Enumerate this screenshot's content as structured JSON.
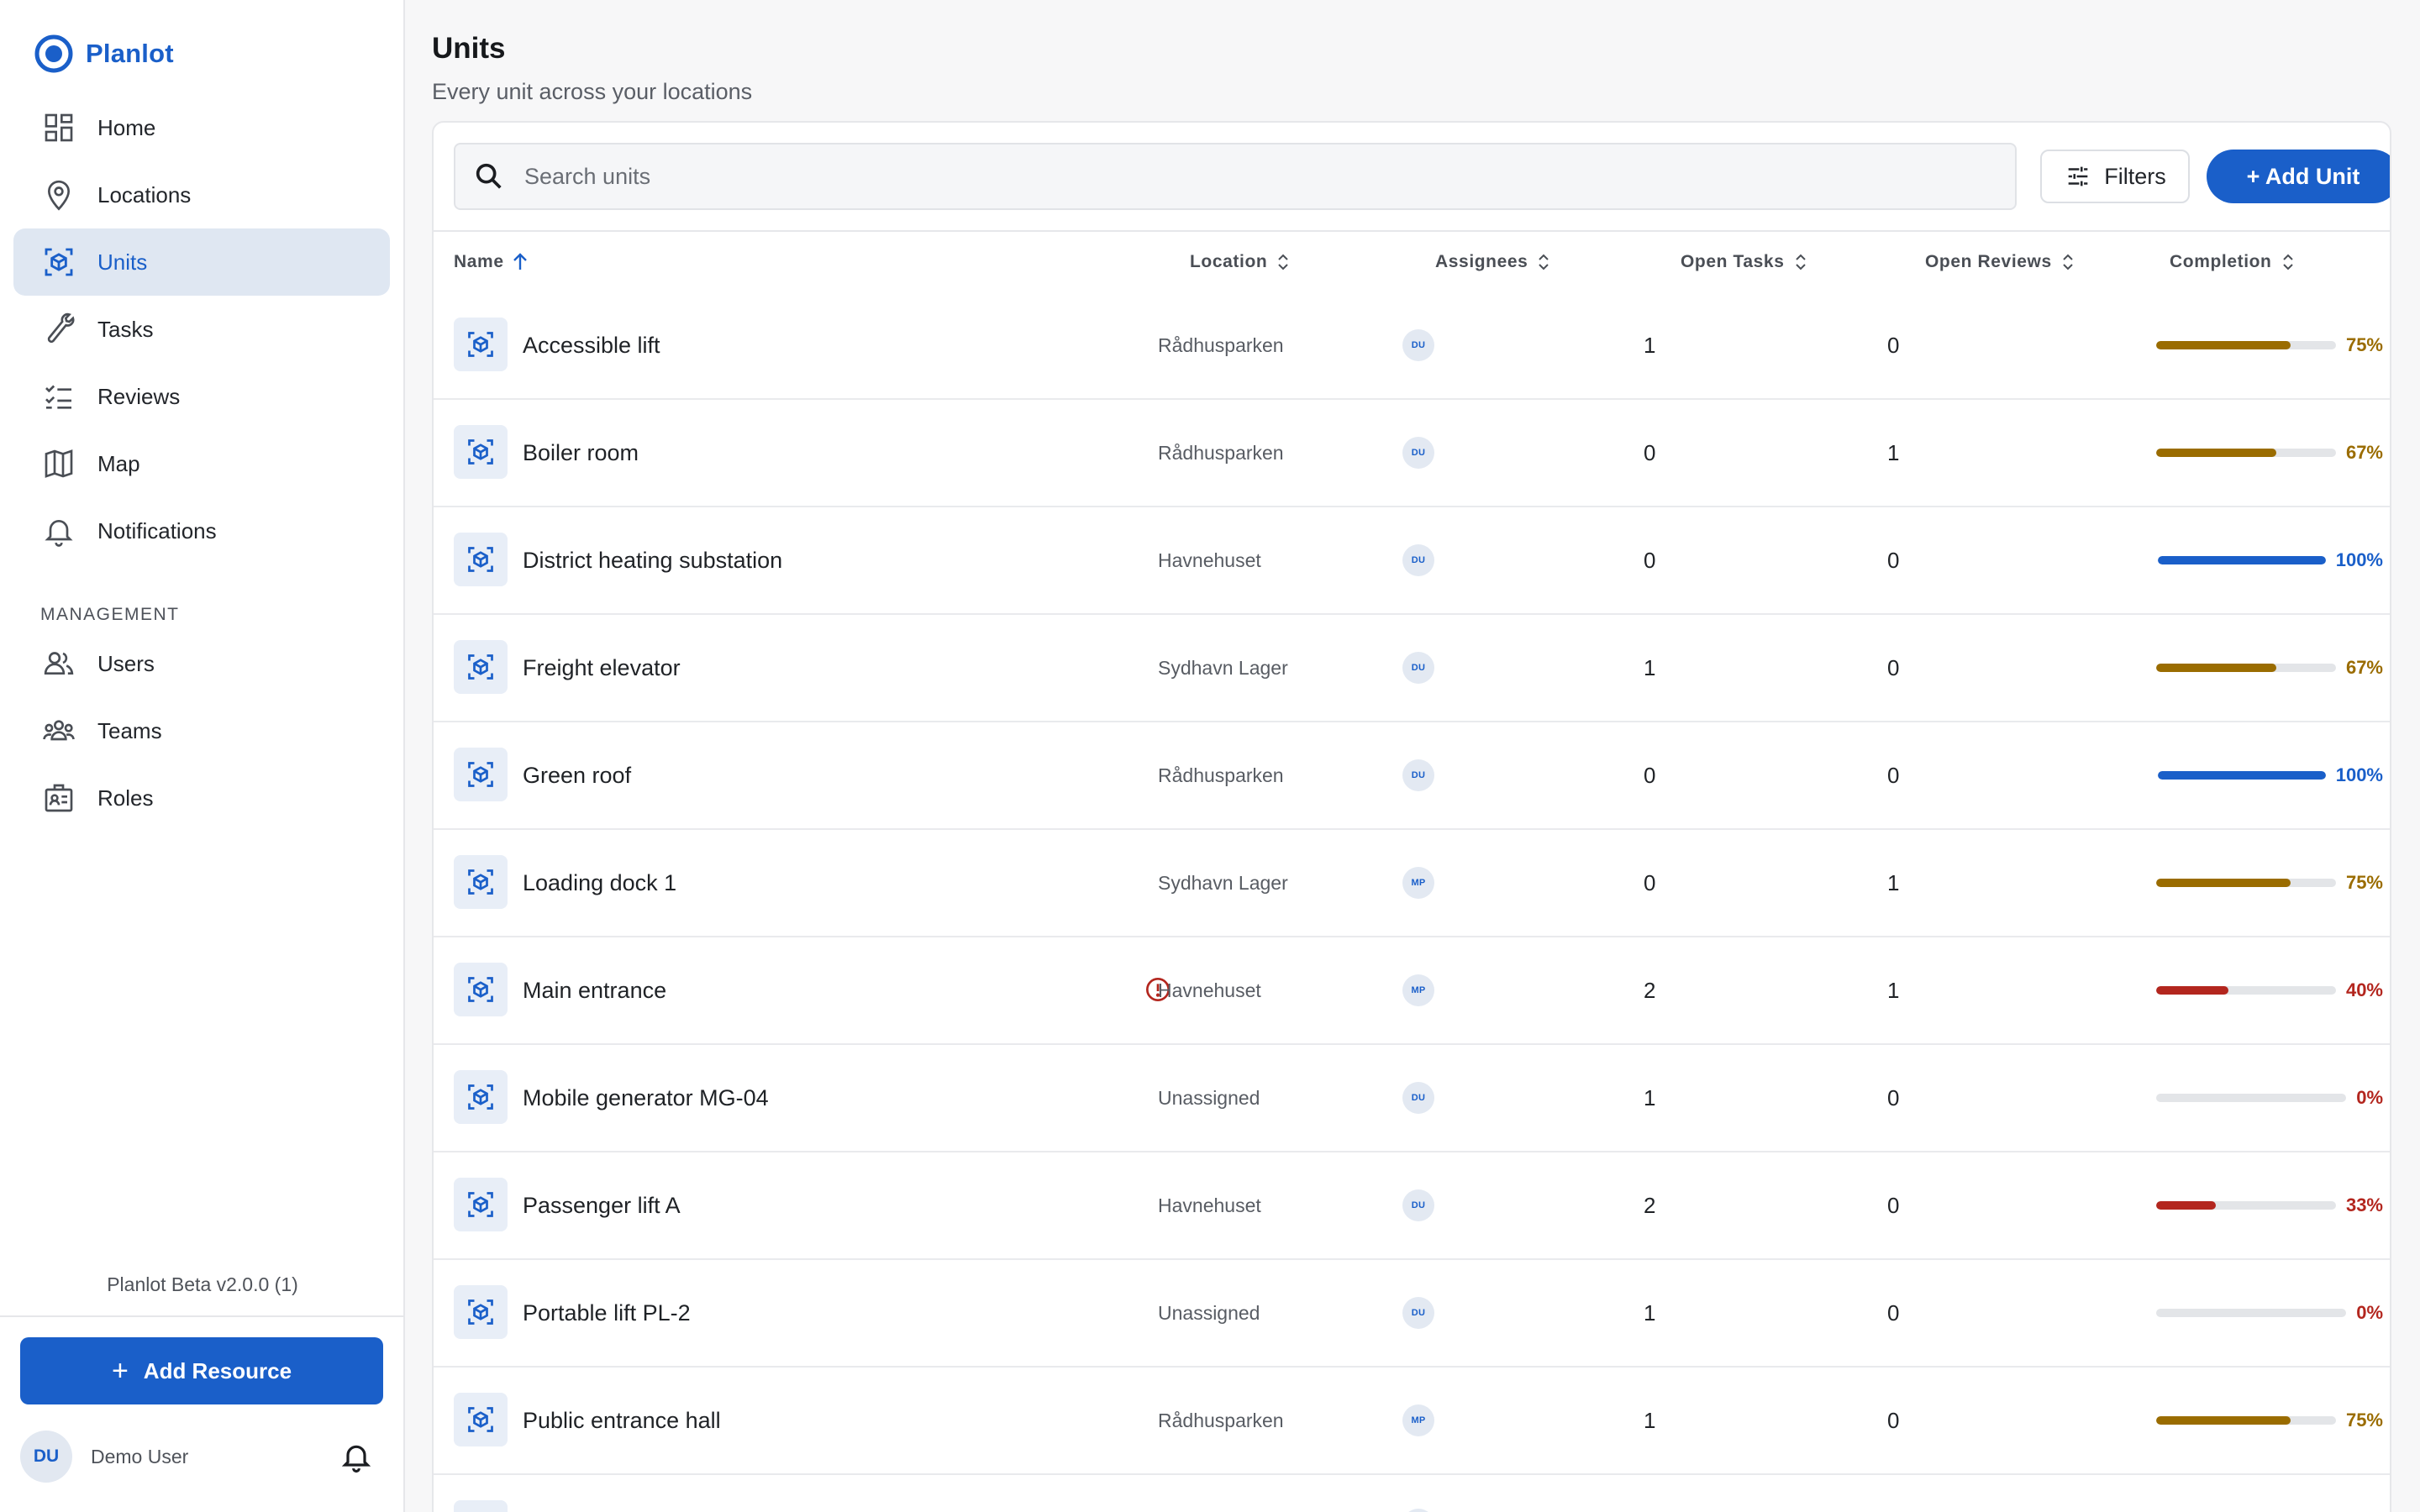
{
  "app": {
    "name": "Planlot",
    "version": "Planlot Beta v2.0.0 (1)"
  },
  "colors": {
    "accent": "#1a5fc9",
    "good": "#1a5fc9",
    "mid": "#9a6c00",
    "low": "#b3261e",
    "zero": "#b3261e"
  },
  "sidebar": {
    "nav": [
      {
        "label": "Home",
        "icon": "dashboard-icon",
        "active": false
      },
      {
        "label": "Locations",
        "icon": "location-pin-icon",
        "active": false
      },
      {
        "label": "Units",
        "icon": "cube-scan-icon",
        "active": true
      },
      {
        "label": "Tasks",
        "icon": "wrench-icon",
        "active": false
      },
      {
        "label": "Reviews",
        "icon": "checklist-icon",
        "active": false
      },
      {
        "label": "Map",
        "icon": "map-icon",
        "active": false
      },
      {
        "label": "Notifications",
        "icon": "bell-icon",
        "active": false
      }
    ],
    "management_heading": "MANAGEMENT",
    "management": [
      {
        "label": "Users",
        "icon": "users-icon"
      },
      {
        "label": "Teams",
        "icon": "teams-icon"
      },
      {
        "label": "Roles",
        "icon": "roles-icon"
      }
    ],
    "add_resource_label": "Add Resource",
    "user": {
      "initials": "DU",
      "name": "Demo User"
    }
  },
  "page": {
    "title": "Units",
    "subtitle": "Every unit across your locations",
    "search_placeholder": "Search units",
    "filters_label": "Filters",
    "add_unit_label": "+ Add Unit"
  },
  "table": {
    "columns": [
      "Name",
      "Location",
      "Assignees",
      "Open Tasks",
      "Open Reviews",
      "Completion"
    ],
    "rows": [
      {
        "name": "Accessible lift",
        "location": "Rådhusparken",
        "assignee": "DU",
        "open_tasks": "1",
        "open_reviews": "0",
        "completion": 75,
        "completion_label": "75%",
        "warning": false
      },
      {
        "name": "Boiler room",
        "location": "Rådhusparken",
        "assignee": "DU",
        "open_tasks": "0",
        "open_reviews": "1",
        "completion": 67,
        "completion_label": "67%",
        "warning": false
      },
      {
        "name": "District heating substation",
        "location": "Havnehuset",
        "assignee": "DU",
        "open_tasks": "0",
        "open_reviews": "0",
        "completion": 100,
        "completion_label": "100%",
        "warning": false
      },
      {
        "name": "Freight elevator",
        "location": "Sydhavn Lager",
        "assignee": "DU",
        "open_tasks": "1",
        "open_reviews": "0",
        "completion": 67,
        "completion_label": "67%",
        "warning": false
      },
      {
        "name": "Green roof",
        "location": "Rådhusparken",
        "assignee": "DU",
        "open_tasks": "0",
        "open_reviews": "0",
        "completion": 100,
        "completion_label": "100%",
        "warning": false
      },
      {
        "name": "Loading dock 1",
        "location": "Sydhavn Lager",
        "assignee": "MP",
        "open_tasks": "0",
        "open_reviews": "1",
        "completion": 75,
        "completion_label": "75%",
        "warning": false
      },
      {
        "name": "Main entrance",
        "location": "Havnehuset",
        "assignee": "MP",
        "open_tasks": "2",
        "open_reviews": "1",
        "completion": 40,
        "completion_label": "40%",
        "warning": true
      },
      {
        "name": "Mobile generator MG-04",
        "location": "Unassigned",
        "assignee": "DU",
        "open_tasks": "1",
        "open_reviews": "0",
        "completion": 0,
        "completion_label": "0%",
        "warning": false
      },
      {
        "name": "Passenger lift A",
        "location": "Havnehuset",
        "assignee": "DU",
        "open_tasks": "2",
        "open_reviews": "0",
        "completion": 33,
        "completion_label": "33%",
        "warning": false
      },
      {
        "name": "Portable lift PL-2",
        "location": "Unassigned",
        "assignee": "DU",
        "open_tasks": "1",
        "open_reviews": "0",
        "completion": 0,
        "completion_label": "0%",
        "warning": false
      },
      {
        "name": "Public entrance hall",
        "location": "Rådhusparken",
        "assignee": "MP",
        "open_tasks": "1",
        "open_reviews": "0",
        "completion": 75,
        "completion_label": "75%",
        "warning": false
      },
      {
        "name": "",
        "location": "",
        "assignee": "",
        "open_tasks": "",
        "open_reviews": "",
        "completion": 0,
        "completion_label": "",
        "warning": false
      }
    ]
  }
}
